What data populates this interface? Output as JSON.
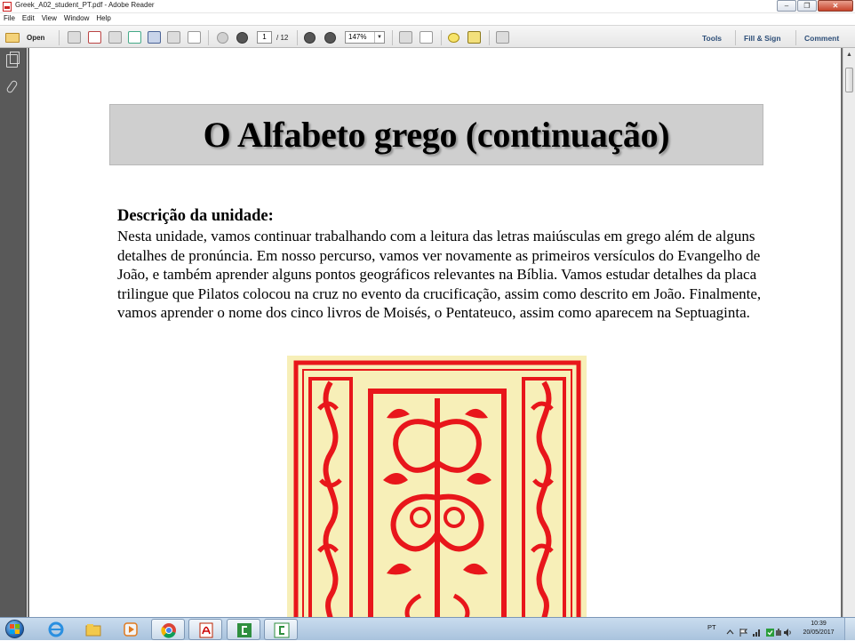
{
  "window": {
    "title": "Greek_A02_student_PT.pdf - Adobe Reader"
  },
  "menu": [
    "File",
    "Edit",
    "View",
    "Window",
    "Help"
  ],
  "toolbar": {
    "open_label": "Open",
    "page_current": "1",
    "page_total": "/ 12",
    "zoom": "147%",
    "tools_label": "Tools",
    "fill_sign_label": "Fill & Sign",
    "comment_label": "Comment"
  },
  "document": {
    "title": "O Alfabeto grego (continuação)",
    "section_heading": "Descrição da unidade:",
    "body": "Nesta unidade, vamos continuar trabalhando com a leitura das letras maiúsculas em grego além de alguns detalhes de pronúncia. Em nosso percurso, vamos ver novamente as primeiros versículos do Evangelho de João, e também aprender alguns pontos geográficos relevantes na Bíblia. Vamos estudar detalhes da placa trilingue que Pilatos colocou na cruz no evento da crucificação, assim como descrito em João. Finalmente, vamos aprender o nome dos cinco livros de Moisés, o Pentateuco, assim como aparecem na Septuaginta."
  },
  "taskbar": {
    "language": "PT",
    "time": "10:39",
    "date": "20/05/2017",
    "apps": [
      "start",
      "internet-explorer",
      "file-explorer",
      "media-player",
      "chrome",
      "adobe-reader",
      "camtasia-recorder",
      "camtasia-studio"
    ]
  },
  "colors": {
    "ornament_red": "#e8161b",
    "ornament_bg": "#f7efb8",
    "title_band": "#cfcfcf",
    "link_blue": "#2d4e78"
  }
}
